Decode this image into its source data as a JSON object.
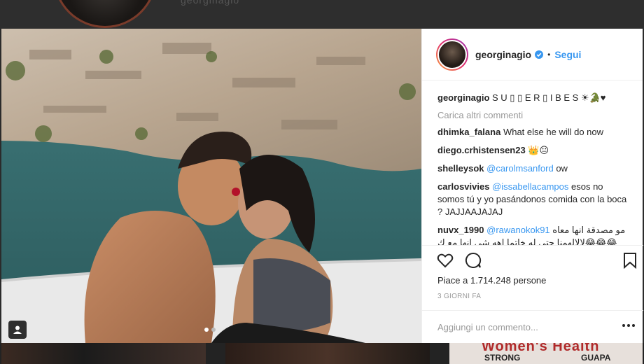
{
  "background": {
    "profile_name": "georginagio",
    "thumb_texts": {
      "brand": "Women's Health",
      "strong": "STRONG",
      "guapa": "GUAPA"
    }
  },
  "post": {
    "username": "georginagio",
    "verified": true,
    "separator": "•",
    "follow_label": "Segui",
    "photo_alt": "Couple sharing food on a boat near rocky cliffs",
    "carousel_total": 2,
    "carousel_active": 1,
    "caption": {
      "user": "georginagio",
      "text": "S U ▯ ▯ E R ▯ I B E S ☀🐊♥"
    },
    "load_more": "Carica altri commenti",
    "comments": [
      {
        "user": "dhimka_falana",
        "mention": "",
        "text": "What else he will do now"
      },
      {
        "user": "diego.crhistensen23",
        "mention": "",
        "text": "👑😐"
      },
      {
        "user": "shelleysok",
        "mention": "@carolmsanford",
        "text": " ow"
      },
      {
        "user": "carlosvivies",
        "mention": "@issabellacampos",
        "text": " esos no somos tú y yo pasándonos comida con la boca ? JAJJAAJAJAJ"
      },
      {
        "user": "nuvx_1990",
        "mention": "@rawanokok91",
        "text": " مو مصدقة انها معاه 😂😂😂لالالهمنا حتى له خاتما اهه شى انها مع ك ستشانه💔"
      }
    ],
    "likes_text": "Piace a 1.714.248 persone",
    "time_ago": "3 GIORNI FA",
    "add_comment_placeholder": "Aggiungi un commento..."
  },
  "colors": {
    "link": "#3897f0",
    "text": "#262626",
    "muted": "#999999",
    "verified": "#3897f0"
  },
  "icons": [
    "heart-icon",
    "comment-icon",
    "bookmark-icon",
    "more-options-icon",
    "tag-user-icon",
    "verified-badge-icon"
  ]
}
